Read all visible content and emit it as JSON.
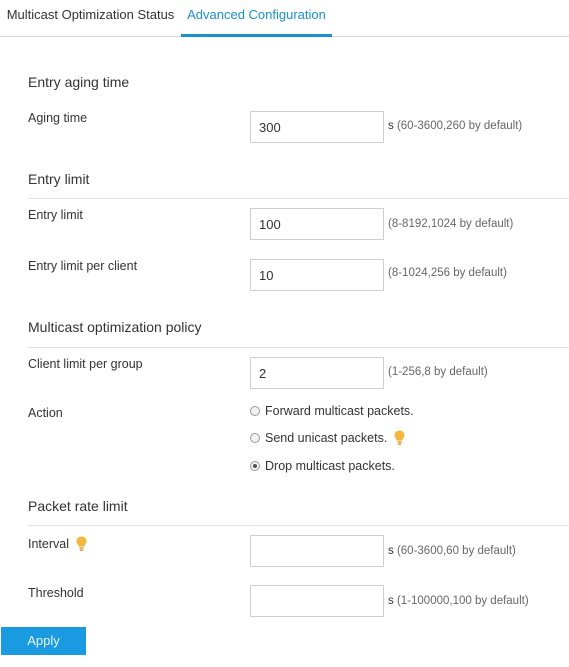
{
  "tabs": [
    {
      "label": "Multicast Optimization Status"
    },
    {
      "label": "Advanced Configuration"
    }
  ],
  "sections": {
    "aging": {
      "title": "Entry aging time",
      "aging_time": {
        "label": "Aging time",
        "value": "300",
        "unit": "s",
        "range": "(60-3600,260 by default)"
      }
    },
    "entry_limit": {
      "title": "Entry limit",
      "entry_limit": {
        "label": "Entry limit",
        "value": "100",
        "range": "(8-8192,1024 by default)"
      },
      "per_client": {
        "label": "Entry limit per client",
        "value": "10",
        "range": "(8-1024,256 by default)"
      }
    },
    "policy": {
      "title": "Multicast optimization policy",
      "client_limit": {
        "label": "Client limit per group",
        "value": "2",
        "range": "(1-256,8 by default)"
      },
      "action": {
        "label": "Action",
        "options": [
          {
            "label": "Forward multicast packets.",
            "checked": false
          },
          {
            "label": "Send unicast packets.",
            "checked": false
          },
          {
            "label": "Drop multicast packets.",
            "checked": true
          }
        ]
      }
    },
    "rate": {
      "title": "Packet rate limit",
      "interval": {
        "label": "Interval",
        "value": "",
        "unit": "s",
        "range": "(60-3600,60 by default)"
      },
      "threshold": {
        "label": "Threshold",
        "value": "",
        "unit": "s",
        "range": "(1-100000,100 by default)"
      }
    }
  },
  "apply_label": "Apply",
  "colors": {
    "accent": "#1a8fd1",
    "button": "#1a9ae0",
    "hint_icon": "#f5b63c"
  }
}
